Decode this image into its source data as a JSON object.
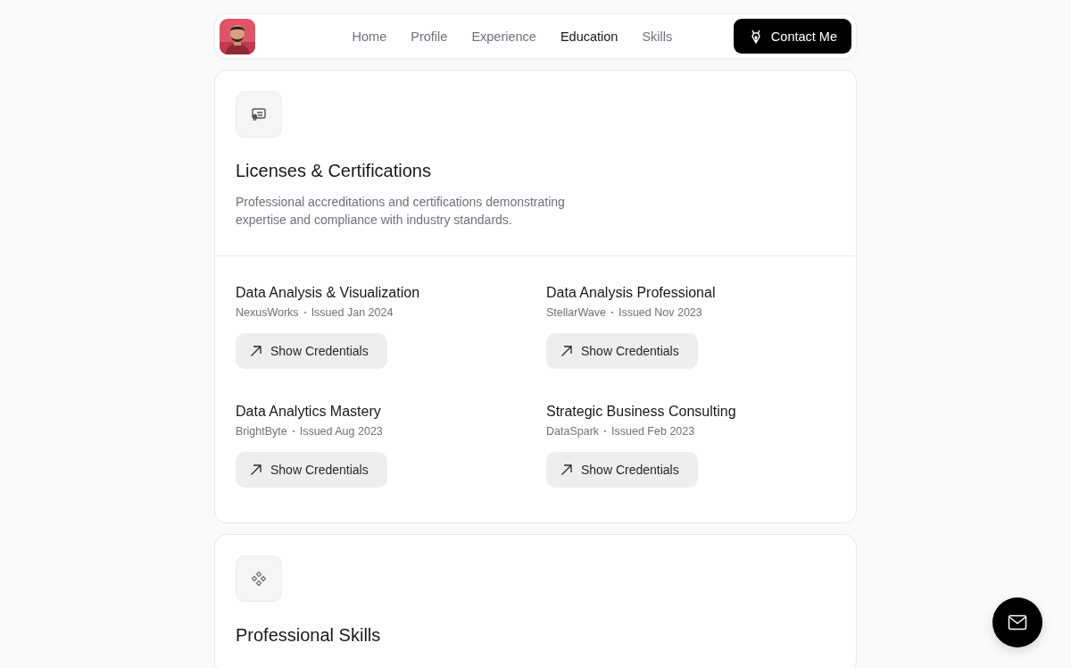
{
  "nav": {
    "links": [
      {
        "label": "Home",
        "selected": false
      },
      {
        "label": "Profile",
        "selected": false
      },
      {
        "label": "Experience",
        "selected": false
      },
      {
        "label": "Education",
        "selected": true
      },
      {
        "label": "Skills",
        "selected": false
      }
    ],
    "contact_button": "Contact Me"
  },
  "sections": [
    {
      "kind": "certs",
      "title": "Licenses & Certifications",
      "description": "Professional accreditations and certifications demonstrating expertise and compliance with industry standards.",
      "certifications": [
        {
          "name": "Data Analysis & Visualization",
          "issuer": "NexusWorks",
          "issued": "Issued Jan 2024",
          "button": "Show Credentials"
        },
        {
          "name": "Data Analysis Professional",
          "issuer": "StellarWave",
          "issued": "Issued Nov 2023",
          "button": "Show Credentials"
        },
        {
          "name": "Data Analytics Mastery",
          "issuer": "BrightByte",
          "issued": "Issued Aug 2023",
          "button": "Show Credentials"
        },
        {
          "name": "Strategic Business Consulting",
          "issuer": "DataSpark",
          "issued": "Issued Feb 2023",
          "button": "Show Credentials"
        }
      ]
    },
    {
      "kind": "skills",
      "title": "Professional Skills"
    }
  ]
}
